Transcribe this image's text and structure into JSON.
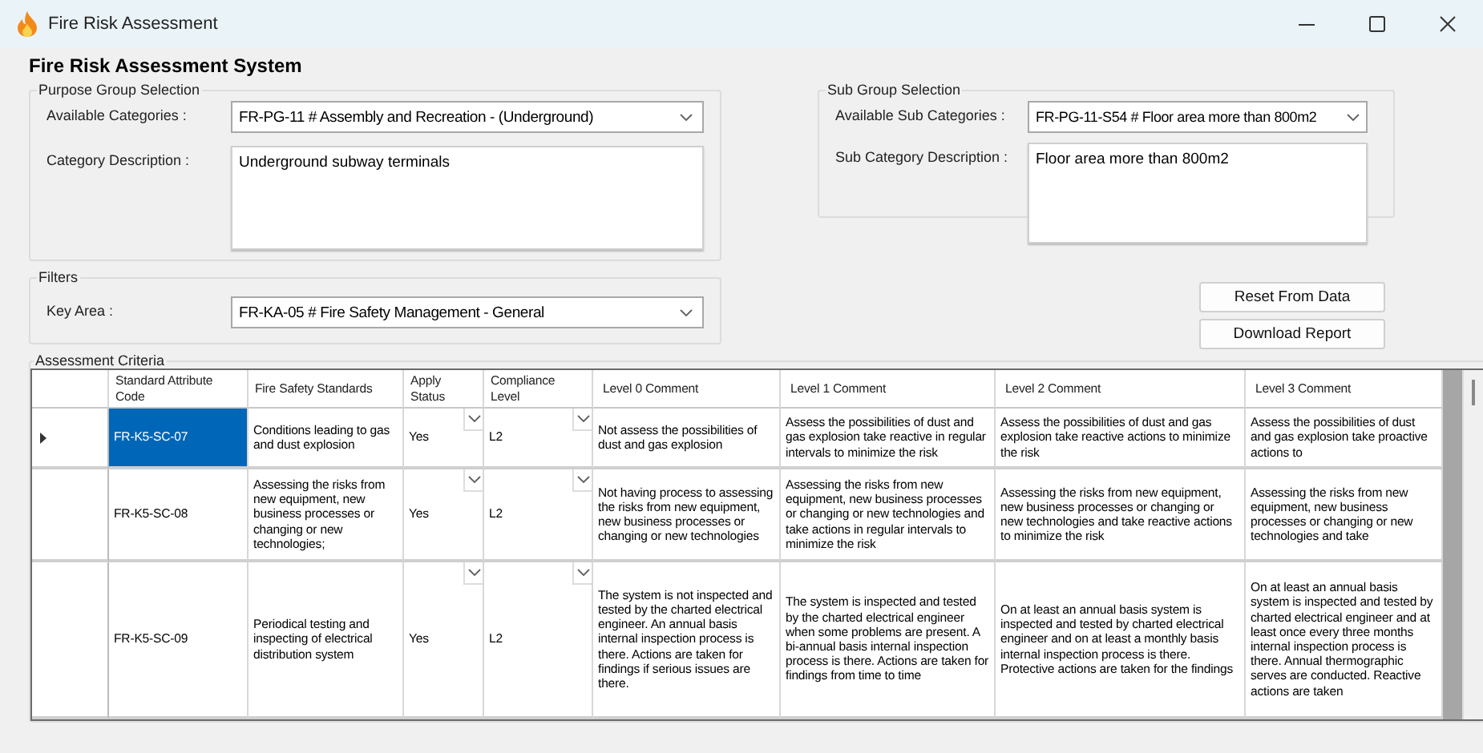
{
  "window": {
    "title": "Fire Risk Assessment"
  },
  "heading": "Fire Risk Assessment System",
  "purpose_group": {
    "title": "Purpose Group Selection",
    "category_label": "Available Categories :",
    "category_value": "FR-PG-11 # Assembly and Recreation - (Underground)",
    "description_label": "Category Description :",
    "description": "Underground subway terminals"
  },
  "sub_group": {
    "title": "Sub Group Selection",
    "category_label": "Available Sub Categories :",
    "category_value": "FR-PG-11-S54 # Floor area more than 800m2",
    "description_label": "Sub Category Description :",
    "description": "Floor area more than 800m2"
  },
  "filters": {
    "title": "Filters",
    "key_area_label": "Key Area :",
    "key_area_value": "FR-KA-05 # Fire Safety Management - General"
  },
  "buttons": [
    "Reset From Data",
    "Download Report"
  ],
  "criteria": {
    "title": "Assessment Criteria",
    "columns": [
      "Standard Attribute Code",
      "Fire Safety Standards",
      "Apply Status",
      "Compliance Level",
      "Level 0 Comment",
      "Level 1 Comment",
      "Level 2 Comment",
      "Level 3 Comment"
    ],
    "rows": [
      {
        "selected": true,
        "code": "FR-K5-SC-07",
        "standard": "Conditions leading to gas and dust explosion",
        "apply_status": "Yes",
        "compliance_level": "L2",
        "level_0_comment": "Not assess the possibilities of dust and gas explosion",
        "level_1_comment": "Assess the possibilities of dust and gas explosion take reactive  in regular intervals  to minimize the risk",
        "level_2_comment": "Assess the possibilities of dust and gas explosion take reactive  actions to minimize the risk",
        "level_3_comment": "Assess the possibilities of dust and gas explosion take proactive actions to"
      },
      {
        "selected": false,
        "code": "FR-K5-SC-08",
        "standard": "Assessing the risks from new equipment, new business processes or changing or new technologies;",
        "apply_status": "Yes",
        "compliance_level": "L2",
        "level_0_comment": "Not having process to assessing the risks from new equipment, new business processes or changing or new technologies",
        "level_1_comment": "Assessing the risks from new equipment, new business processes or changing or new technologies and take actions in regular intervals to minimize the risk",
        "level_2_comment": "Assessing the risks from new equipment, new business processes or changing or new technologies and take reactive actions to minimize the risk",
        "level_3_comment": "Assessing the risks from new equipment, new business processes or changing or new technologies and take"
      },
      {
        "selected": false,
        "code": "FR-K5-SC-09",
        "standard": "Periodical testing and inspecting of electrical distribution system",
        "apply_status": "Yes",
        "compliance_level": "L2",
        "level_0_comment": "The system is not inspected and tested by the charted electrical engineer. An annual basis internal inspection process is there. Actions are taken for findings if serious issues are there.",
        "level_1_comment": "The system is inspected and tested by the charted electrical engineer when some problems are present. A bi-annual basis internal inspection process is there. Actions are taken for findings from time to time",
        "level_2_comment": "On at least an annual basis system is inspected and tested by charted electrical engineer and on at least a monthly basis internal inspection process is there. Protective actions are taken for the findings",
        "level_3_comment": "On at least an annual basis system is inspected and tested by charted electrical engineer and at least once every three months internal inspection process is there. Annual thermographic serves are conducted. Reactive actions are taken"
      }
    ]
  }
}
